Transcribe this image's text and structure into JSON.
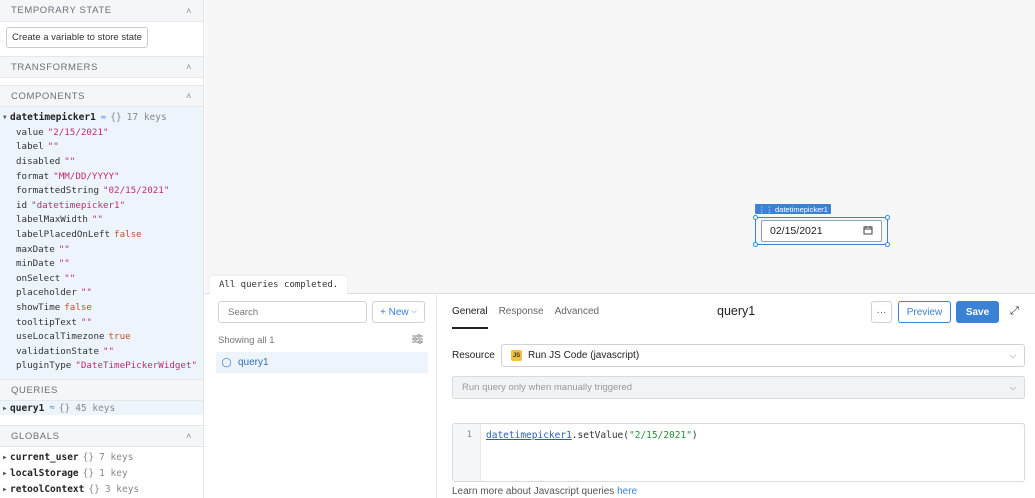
{
  "left": {
    "temporary_state": {
      "title": "TEMPORARY STATE",
      "create_button": "Create a variable to store state"
    },
    "transformers": {
      "title": "TRANSFORMERS"
    },
    "components": {
      "title": "COMPONENTS",
      "root": {
        "name": "datetimepicker1",
        "brace": "{}",
        "keys": "17 keys"
      },
      "props": [
        {
          "key": "value",
          "val": "\"2/15/2021\"",
          "kind": "str"
        },
        {
          "key": "label",
          "val": "\"\"",
          "kind": "str"
        },
        {
          "key": "disabled",
          "val": "\"\"",
          "kind": "str"
        },
        {
          "key": "format",
          "val": "\"MM/DD/YYYY\"",
          "kind": "str"
        },
        {
          "key": "formattedString",
          "val": "\"02/15/2021\"",
          "kind": "str"
        },
        {
          "key": "id",
          "val": "\"datetimepicker1\"",
          "kind": "str"
        },
        {
          "key": "labelMaxWidth",
          "val": "\"\"",
          "kind": "str"
        },
        {
          "key": "labelPlacedOnLeft",
          "val": "false",
          "kind": "bool"
        },
        {
          "key": "maxDate",
          "val": "\"\"",
          "kind": "str"
        },
        {
          "key": "minDate",
          "val": "\"\"",
          "kind": "str"
        },
        {
          "key": "onSelect",
          "val": "\"\"",
          "kind": "str"
        },
        {
          "key": "placeholder",
          "val": "\"\"",
          "kind": "str"
        },
        {
          "key": "showTime",
          "val": "false",
          "kind": "bool"
        },
        {
          "key": "tooltipText",
          "val": "\"\"",
          "kind": "str"
        },
        {
          "key": "useLocalTimezone",
          "val": "true",
          "kind": "bool"
        },
        {
          "key": "validationState",
          "val": "\"\"",
          "kind": "str"
        },
        {
          "key": "pluginType",
          "val": "\"DateTimePickerWidget\"",
          "kind": "str"
        }
      ]
    },
    "queries": {
      "title": "QUERIES",
      "item": {
        "name": "query1",
        "brace": "{}",
        "keys": "45 keys"
      }
    },
    "globals": {
      "title": "GLOBALS",
      "items": [
        {
          "name": "current_user",
          "brace": "{}",
          "keys": "7 keys"
        },
        {
          "name": "localStorage",
          "brace": "{}",
          "keys": "1 key"
        },
        {
          "name": "retoolContext",
          "brace": "{}",
          "keys": "3 keys"
        }
      ]
    }
  },
  "canvas": {
    "widget_tag": "datetimepicker1",
    "date_value": "02/15/2021",
    "toast": "All queries completed."
  },
  "query_list": {
    "search_placeholder": "Search",
    "new_button": "+ New",
    "showing": "Showing all 1",
    "items": [
      {
        "name": "query1"
      }
    ]
  },
  "editor": {
    "tabs": [
      {
        "label": "General",
        "active": true
      },
      {
        "label": "Response"
      },
      {
        "label": "Advanced"
      }
    ],
    "title": "query1",
    "more": "···",
    "preview": "Preview",
    "save": "Save",
    "resource_label": "Resource",
    "resource_value": "Run JS Code (javascript)",
    "trigger_value": "Run query only when manually triggered",
    "code_line_no": "1",
    "code": {
      "fn": "datetimepicker1",
      "method": ".setValue(",
      "arg": "\"2/15/2021\"",
      "close": ")"
    },
    "learn_text": "Learn more about Javascript queries ",
    "learn_link": "here"
  },
  "colors": {
    "accent": "#3b82d6",
    "string": "#c02a72",
    "bool": "#c6502a"
  },
  "icons": [
    "chevron-up-icon",
    "caret-right-icon",
    "broadcast-icon",
    "calendar-icon",
    "filter-icon",
    "query-icon",
    "js-icon",
    "expand-icon",
    "dropdown-icon"
  ]
}
